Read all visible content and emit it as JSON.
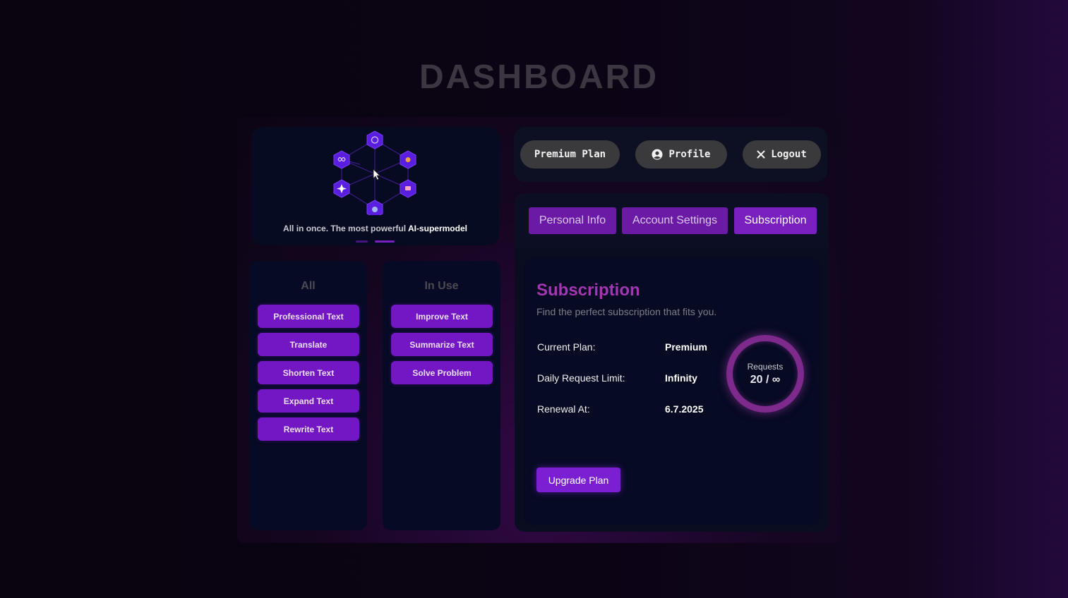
{
  "page_title": "DASHBOARD",
  "hero": {
    "tagline_prefix": "All in once. The most powerful ",
    "tagline_highlight": "AI-supermodel",
    "model_icons": [
      "openai-icon",
      "claude-icon",
      "mistral-icon",
      "deepseek-icon",
      "gemini-icon",
      "meta-icon"
    ]
  },
  "topbar": {
    "premium_label": "Premium Plan",
    "profile_label": "Profile",
    "logout_label": "Logout"
  },
  "columns": {
    "all": {
      "heading": "All",
      "items": [
        "Professional Text",
        "Translate",
        "Shorten Text",
        "Expand Text",
        "Rewrite Text"
      ]
    },
    "in_use": {
      "heading": "In Use",
      "items": [
        "Improve Text",
        "Summarize Text",
        "Solve Problem"
      ]
    }
  },
  "tabs": [
    {
      "label": "Personal Info",
      "active": false
    },
    {
      "label": "Account Settings",
      "active": false
    },
    {
      "label": "Subscription",
      "active": true
    }
  ],
  "subscription": {
    "title": "Subscription",
    "subtitle": "Find the perfect subscription that fits you.",
    "rows": [
      {
        "label": "Current Plan:",
        "value": "Premium"
      },
      {
        "label": "Daily Request Limit:",
        "value": "Infinity"
      },
      {
        "label": "Renewal At:",
        "value": "6.7.2025"
      }
    ],
    "requests_label": "Requests",
    "requests_value": "20 / ∞",
    "upgrade_label": "Upgrade Plan"
  },
  "colors": {
    "accent": "#7316c4",
    "title_magenta": "#a336b2",
    "ring": "#7d2a8c"
  }
}
